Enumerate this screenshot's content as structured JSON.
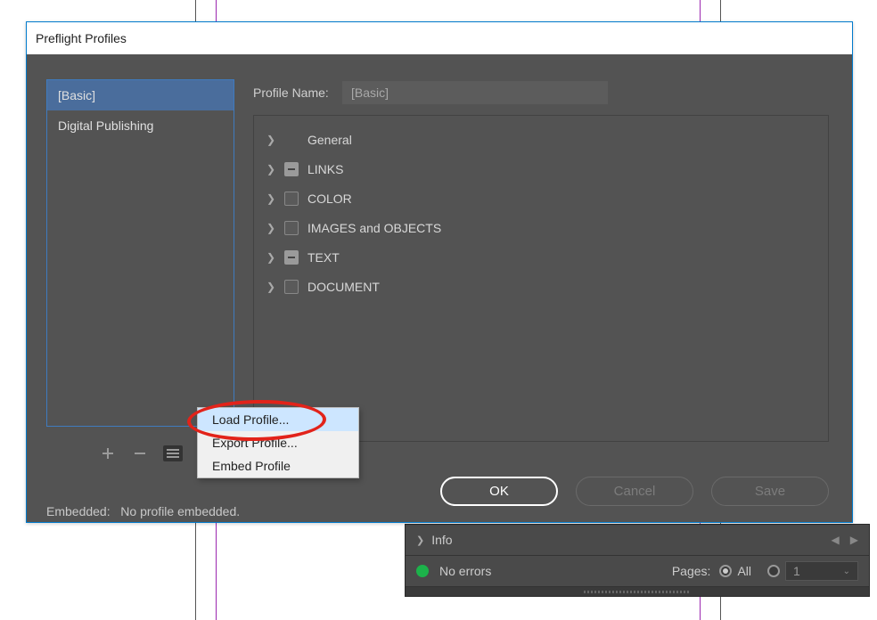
{
  "dialog": {
    "title": "Preflight Profiles",
    "profile_name_label": "Profile Name:",
    "profile_name_value": "[Basic]",
    "embedded_label": "Embedded:",
    "embedded_value": "No profile embedded.",
    "profiles": [
      {
        "label": "[Basic]",
        "selected": true
      },
      {
        "label": "Digital Publishing",
        "selected": false
      }
    ],
    "categories": [
      {
        "label": "General",
        "checkbox": "none"
      },
      {
        "label": "LINKS",
        "checkbox": "mixed"
      },
      {
        "label": "COLOR",
        "checkbox": "unchecked"
      },
      {
        "label": "IMAGES and OBJECTS",
        "checkbox": "unchecked"
      },
      {
        "label": "TEXT",
        "checkbox": "mixed"
      },
      {
        "label": "DOCUMENT",
        "checkbox": "unchecked"
      }
    ],
    "buttons": {
      "ok": "OK",
      "cancel": "Cancel",
      "save": "Save"
    },
    "menu": {
      "load": "Load Profile...",
      "export": "Export Profile...",
      "embed": "Embed Profile"
    }
  },
  "status": {
    "info_label": "Info",
    "no_errors": "No errors",
    "pages_label": "Pages:",
    "all_label": "All",
    "page_value": "1"
  }
}
